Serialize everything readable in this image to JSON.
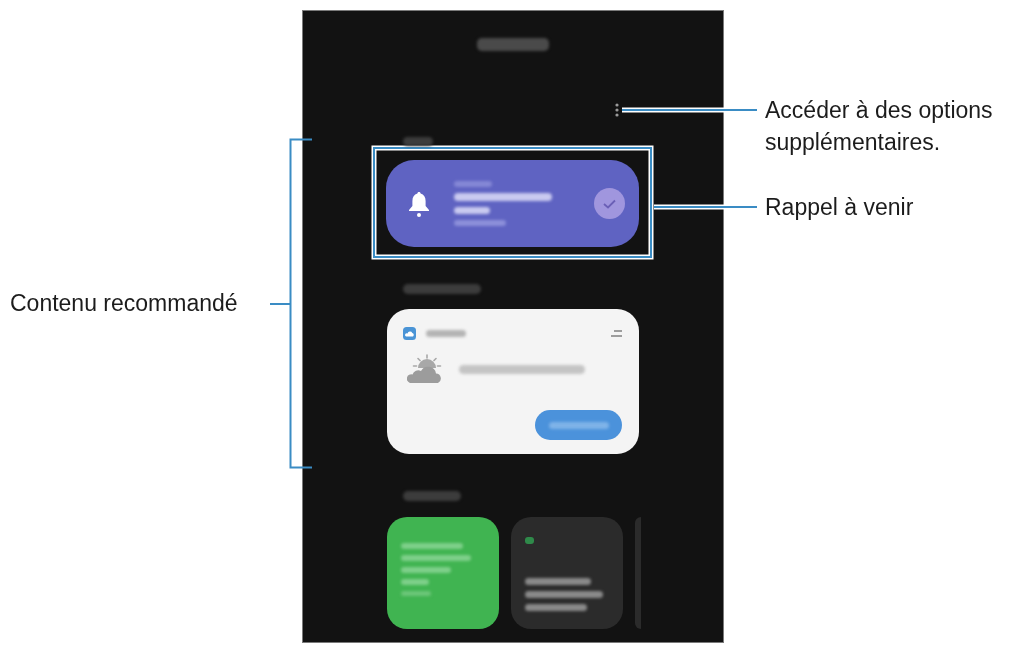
{
  "callouts": [
    {
      "kind": "leader",
      "text": "Accéder à des options supplémentaires."
    },
    {
      "kind": "leader",
      "text": "Rappel à venir"
    },
    {
      "kind": "bracket",
      "text": "Contenu recommandé"
    }
  ]
}
